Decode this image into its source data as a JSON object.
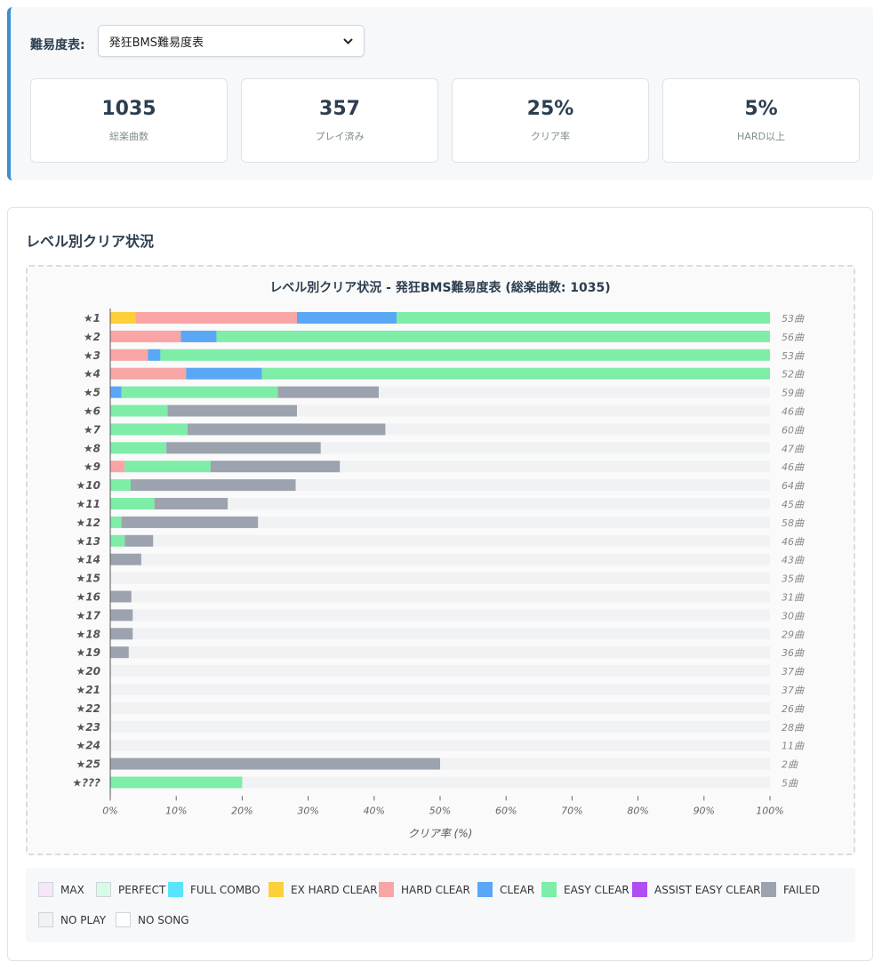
{
  "header": {
    "selector_label": "難易度表:",
    "selected_table": "発狂BMS難易度表",
    "stats": [
      {
        "value": "1035",
        "label": "総楽曲数"
      },
      {
        "value": "357",
        "label": "プレイ済み"
      },
      {
        "value": "25%",
        "label": "クリア率"
      },
      {
        "value": "5%",
        "label": "HARD以上"
      }
    ]
  },
  "section": {
    "title": "レベル別クリア状況"
  },
  "chart_data": {
    "type": "bar",
    "orientation": "horizontal",
    "stacked": true,
    "title": "レベル別クリア状況 - 発狂BMS難易度表 (総楽曲数: 1035)",
    "xlabel": "クリア率 (%)",
    "ylabel": "",
    "xlim": [
      0,
      100
    ],
    "xticks": [
      "0%",
      "10%",
      "20%",
      "30%",
      "40%",
      "50%",
      "60%",
      "70%",
      "80%",
      "90%",
      "100%"
    ],
    "categories": [
      "★1",
      "★2",
      "★3",
      "★4",
      "★5",
      "★6",
      "★7",
      "★8",
      "★9",
      "★10",
      "★11",
      "★12",
      "★13",
      "★14",
      "★15",
      "★16",
      "★17",
      "★18",
      "★19",
      "★20",
      "★21",
      "★22",
      "★23",
      "★24",
      "★25",
      "★???"
    ],
    "song_counts": [
      "53曲",
      "56曲",
      "53曲",
      "52曲",
      "59曲",
      "46曲",
      "60曲",
      "47曲",
      "46曲",
      "64曲",
      "45曲",
      "58曲",
      "46曲",
      "43曲",
      "35曲",
      "31曲",
      "30曲",
      "29曲",
      "36曲",
      "37曲",
      "37曲",
      "26曲",
      "28曲",
      "11曲",
      "2曲",
      "5曲"
    ],
    "series": [
      {
        "name": "EX HARD CLEAR",
        "color": "#fdd03b",
        "values": [
          3.8,
          0,
          0,
          0,
          0,
          0,
          0,
          0,
          0,
          0,
          0,
          0,
          0,
          0,
          0,
          0,
          0,
          0,
          0,
          0,
          0,
          0,
          0,
          0,
          0,
          0
        ]
      },
      {
        "name": "HARD CLEAR",
        "color": "#f9a5a5",
        "values": [
          24.5,
          10.7,
          5.7,
          11.5,
          0,
          0,
          0,
          0,
          2.2,
          0,
          0,
          0,
          0,
          0,
          0,
          0,
          0,
          0,
          0,
          0,
          0,
          0,
          0,
          0,
          0,
          0
        ]
      },
      {
        "name": "CLEAR",
        "color": "#5aa7f5",
        "values": [
          15.1,
          5.4,
          1.9,
          11.5,
          1.7,
          0,
          0,
          0,
          0,
          0,
          0,
          0,
          0,
          0,
          0,
          0,
          0,
          0,
          0,
          0,
          0,
          0,
          0,
          0,
          0,
          0
        ]
      },
      {
        "name": "EASY CLEAR",
        "color": "#7eeda8",
        "values": [
          56.6,
          83.9,
          92.4,
          77.0,
          23.7,
          8.7,
          11.7,
          8.5,
          13.0,
          3.1,
          6.7,
          1.7,
          2.2,
          0,
          0,
          0,
          0,
          0,
          0,
          0,
          0,
          0,
          0,
          0,
          0,
          20.0
        ]
      },
      {
        "name": "FAILED",
        "color": "#9ca3af",
        "values": [
          0,
          0,
          0,
          0,
          15.3,
          19.6,
          30.0,
          23.4,
          19.6,
          25.0,
          11.1,
          20.7,
          4.3,
          4.7,
          0,
          3.2,
          3.4,
          3.4,
          2.8,
          0,
          0,
          0,
          0,
          0,
          50.0,
          0
        ]
      }
    ],
    "background_color": "#f1f2f4"
  },
  "legend": {
    "items": [
      {
        "name": "MAX",
        "color": "#f5e6fa"
      },
      {
        "name": "PERFECT",
        "color": "#d8fbe5"
      },
      {
        "name": "FULL COMBO",
        "color": "#5ae4fb"
      },
      {
        "name": "EX HARD CLEAR",
        "color": "#fdd03b"
      },
      {
        "name": "HARD CLEAR",
        "color": "#f9a5a5"
      },
      {
        "name": "CLEAR",
        "color": "#5aa7f5"
      },
      {
        "name": "EASY CLEAR",
        "color": "#7eeda8"
      },
      {
        "name": "ASSIST EASY CLEAR",
        "color": "#b04df3"
      },
      {
        "name": "FAILED",
        "color": "#9ca3af"
      },
      {
        "name": "NO PLAY",
        "color": "#f1f2f4"
      },
      {
        "name": "NO SONG",
        "color": "#ffffff"
      }
    ]
  }
}
